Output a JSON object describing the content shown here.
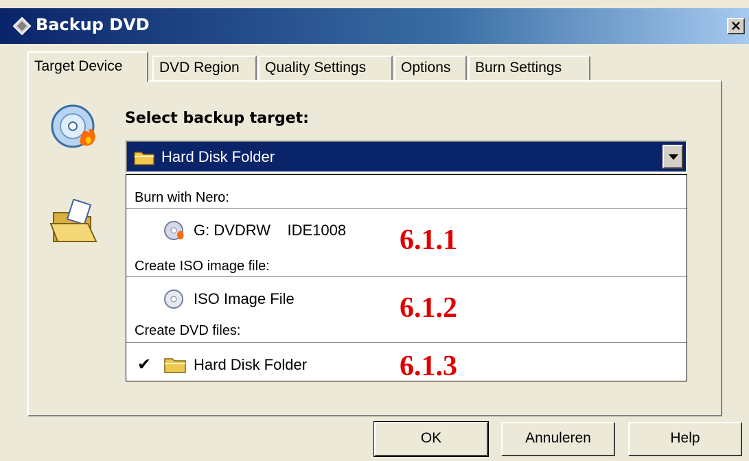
{
  "window": {
    "title": "Backup DVD",
    "close_label": "×"
  },
  "tabs": [
    {
      "label": "Target Device",
      "active": true
    },
    {
      "label": "DVD Region"
    },
    {
      "label": "Quality Settings"
    },
    {
      "label": "Options"
    },
    {
      "label": "Burn Settings"
    }
  ],
  "main": {
    "select_label": "Select backup target:",
    "selected_value": "Hard Disk Folder"
  },
  "dropdown": {
    "groups": [
      {
        "label": "Burn with Nero:",
        "item": "G: DVDRW    IDE1008",
        "icon": "dvd-burn-icon",
        "annotation": "6.1.1"
      },
      {
        "label": "Create ISO image file:",
        "item": "ISO Image File",
        "icon": "iso-disc-icon",
        "annotation": "6.1.2"
      },
      {
        "label": "Create DVD files:",
        "item": "Hard Disk Folder",
        "icon": "folder-icon",
        "annotation": "6.1.3",
        "checked": true
      }
    ],
    "check_mark": "✔"
  },
  "buttons": {
    "ok": "OK",
    "cancel": "Annuleren",
    "help": "Help"
  },
  "colors": {
    "titlebar": "#0a246a",
    "selection": "#0a246a",
    "annotation": "#e00000",
    "dialog_bg": "#ece9d8"
  }
}
